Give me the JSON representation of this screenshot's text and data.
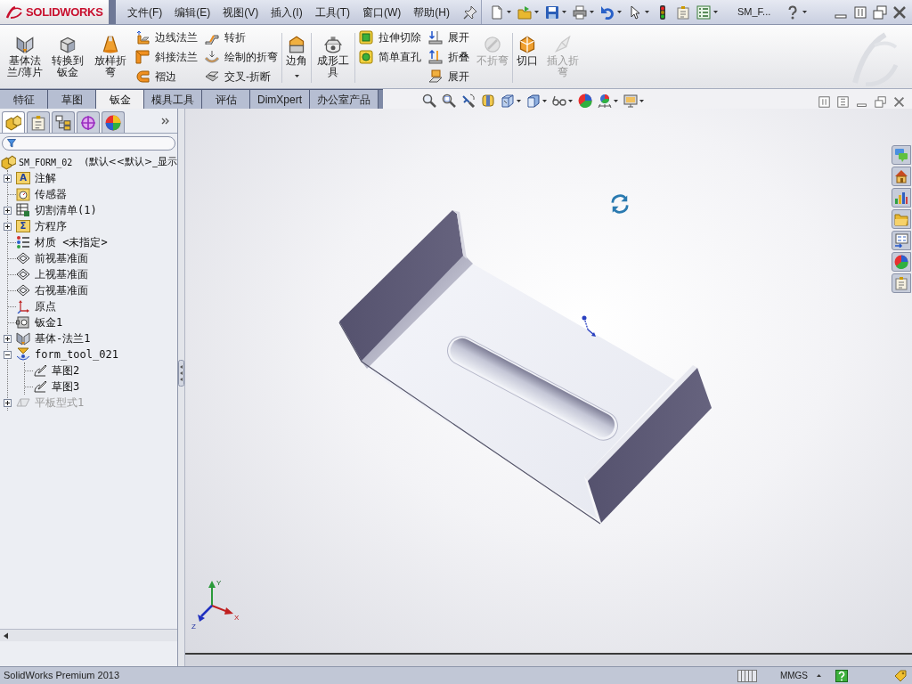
{
  "title_bar": {
    "app_name": "SOLIDWORKS",
    "menu": [
      "文件(F)",
      "编辑(E)",
      "视图(V)",
      "插入(I)",
      "工具(T)",
      "窗口(W)",
      "帮助(H)"
    ]
  },
  "quick_access": {
    "tools": [
      {
        "dropdown": true
      },
      {
        "dropdown": true
      },
      {
        "dropdown": true
      },
      {
        "dropdown": true
      },
      {
        "dropdown": true
      },
      {
        "dropdown": true
      },
      {
        "dropdown": false
      },
      {
        "dropdown": false
      },
      {
        "dropdown": true
      }
    ],
    "document_name": "SM_F...",
    "help": {
      "dropdown": true
    }
  },
  "ribbon": {
    "sections": [
      {
        "groups": [
          {
            "kind": "large",
            "buttons": [
              {
                "label": "基体法兰/薄片",
                "disabled": false,
                "dropdown": false
              },
              {
                "label": "转换到钣金",
                "disabled": false,
                "dropdown": false
              },
              {
                "label": "放样折弯",
                "disabled": false,
                "dropdown": false
              }
            ]
          },
          {
            "kind": "small",
            "buttons": [
              {
                "label": "边线法兰",
                "disabled": false,
                "dropdown": false
              },
              {
                "label": "斜接法兰",
                "disabled": false,
                "dropdown": false
              },
              {
                "label": "褶边",
                "disabled": false,
                "dropdown": false
              }
            ]
          },
          {
            "kind": "small",
            "buttons": [
              {
                "label": "转折",
                "disabled": false,
                "dropdown": false
              },
              {
                "label": "绘制的折弯",
                "disabled": false,
                "dropdown": false
              },
              {
                "label": "交叉-折断",
                "disabled": false,
                "dropdown": false
              }
            ]
          }
        ]
      },
      {
        "groups": [
          {
            "kind": "large",
            "buttons": [
              {
                "label": "边角",
                "disabled": false,
                "dropdown": true
              }
            ]
          }
        ]
      },
      {
        "groups": [
          {
            "kind": "large",
            "buttons": [
              {
                "label": "成形工具",
                "disabled": false,
                "dropdown": false
              }
            ]
          }
        ]
      },
      {
        "groups": [
          {
            "kind": "small",
            "buttons": [
              {
                "label": "拉伸切除",
                "disabled": false,
                "dropdown": false
              },
              {
                "label": "简单直孔",
                "disabled": false,
                "dropdown": false
              }
            ]
          },
          {
            "kind": "small",
            "buttons": [
              {
                "label": "展开",
                "disabled": false,
                "dropdown": false
              },
              {
                "label": "折叠",
                "disabled": false,
                "dropdown": false
              },
              {
                "label": "展开",
                "disabled": false,
                "dropdown": false
              }
            ]
          },
          {
            "kind": "large",
            "buttons": [
              {
                "label": "不折弯",
                "disabled": true,
                "dropdown": false
              }
            ]
          }
        ]
      },
      {
        "groups": [
          {
            "kind": "large",
            "buttons": [
              {
                "label": "切口",
                "disabled": false,
                "dropdown": false
              },
              {
                "label": "插入折弯",
                "disabled": true,
                "dropdown": false
              }
            ]
          }
        ]
      }
    ]
  },
  "command_tabs": [
    {
      "label": "特征",
      "selected": false
    },
    {
      "label": "草图",
      "selected": false
    },
    {
      "label": "钣金",
      "selected": true
    },
    {
      "label": "模具工具",
      "selected": false
    },
    {
      "label": "评估",
      "selected": false
    },
    {
      "label": "DimXpert",
      "selected": false
    },
    {
      "label": "办公室产品",
      "selected": false
    }
  ],
  "view_toolbar": {
    "tools": [
      {
        "dropdown": false
      },
      {
        "dropdown": false
      },
      {
        "dropdown": false
      },
      {
        "dropdown": false
      },
      {
        "dropdown": true
      },
      {
        "dropdown": true
      },
      {
        "dropdown": true
      },
      {
        "dropdown": false
      },
      {
        "dropdown": true
      },
      {
        "dropdown": true
      }
    ]
  },
  "feature_manager": {
    "tabs": [
      {
        "selected": true
      },
      {
        "selected": false
      },
      {
        "selected": false
      },
      {
        "selected": false
      },
      {
        "selected": false
      }
    ],
    "tree": {
      "root": {
        "label": "SM_FORM_02",
        "configuration": "(默认<<默认>_显示"
      },
      "items": [
        {
          "kind": "annotations",
          "label": "注解",
          "glyph": "A",
          "has_children": true,
          "expanded": false,
          "suppressed": false
        },
        {
          "kind": "sensors",
          "label": "传感器",
          "has_children": false,
          "suppressed": false
        },
        {
          "kind": "cut-list",
          "label": "切割清单(1)",
          "has_children": true,
          "expanded": false,
          "suppressed": false
        },
        {
          "kind": "equations",
          "label": "方程序",
          "glyph": "Σ",
          "has_children": true,
          "expanded": false,
          "suppressed": false
        },
        {
          "kind": "material",
          "label": "材质 <未指定>",
          "has_children": false,
          "suppressed": false
        },
        {
          "kind": "plane",
          "label": "前视基准面",
          "has_children": false,
          "suppressed": false
        },
        {
          "kind": "plane",
          "label": "上视基准面",
          "has_children": false,
          "suppressed": false
        },
        {
          "kind": "plane",
          "label": "右视基准面",
          "has_children": false,
          "suppressed": false
        },
        {
          "kind": "origin",
          "label": "原点",
          "has_children": false,
          "suppressed": false
        },
        {
          "kind": "sheet-metal",
          "label": "钣金1",
          "has_children": false,
          "suppressed": false
        },
        {
          "kind": "base-flange",
          "label": "基体-法兰1",
          "has_children": true,
          "expanded": false,
          "suppressed": false
        },
        {
          "kind": "form-tool",
          "label": "form_tool_021",
          "has_children": true,
          "expanded": true,
          "suppressed": false,
          "children": [
            {
              "kind": "sketch",
              "label": "草图2",
              "has_children": false,
              "suppressed": false
            },
            {
              "kind": "sketch",
              "label": "草图3",
              "has_children": false,
              "suppressed": false
            }
          ]
        },
        {
          "kind": "flat-pattern",
          "label": "平板型式1",
          "has_children": true,
          "expanded": false,
          "suppressed": true
        }
      ]
    }
  },
  "viewport": {
    "triad": {
      "x_label": "X",
      "y_label": "Y",
      "z_label": "Z"
    }
  },
  "status_bar": {
    "product": "SolidWorks Premium 2013",
    "units": "MMGS"
  }
}
